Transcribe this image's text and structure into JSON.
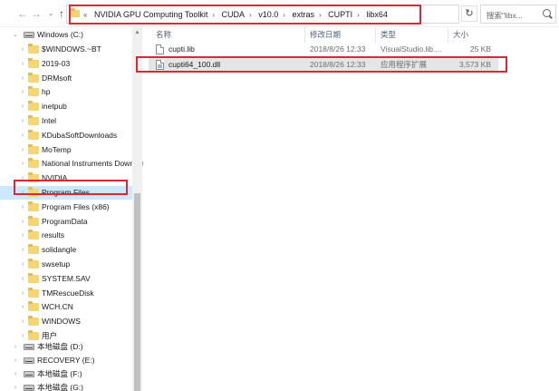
{
  "address_bar": {
    "breadcrumbs": [
      "NVIDIA GPU Computing Toolkit",
      "CUDA",
      "v10.0",
      "extras",
      "CUPTI",
      "libx64"
    ],
    "overflow_chevron": "«",
    "search_placeholder": "搜索\"libx..."
  },
  "nav_icons": {
    "back": "←",
    "forward": "→",
    "history": "⌄",
    "up": "↑",
    "refresh": "↻",
    "dropdown": "⌄"
  },
  "tree": {
    "root_label": "Windows (C:)",
    "folders": [
      "$WINDOWS.~BT",
      "2019-03",
      "DRMsoft",
      "hp",
      "inetpub",
      "Intel",
      "KDubaSoftDownloads",
      "MoTemp",
      "National Instruments Downloads",
      "NVIDIA",
      "Program Files",
      "Program Files (x86)",
      "ProgramData",
      "results",
      "solidangle",
      "swsetup",
      "SYSTEM.SAV",
      "TMRescueDisk",
      "WCH.CN",
      "WINDOWS",
      "用户"
    ],
    "selected": "Program Files",
    "drives": [
      "本地磁盘 (D:)",
      "RECOVERY (E:)",
      "本地磁盘 (F:)",
      "本地磁盘 (G:)"
    ]
  },
  "columns": {
    "name": "名称",
    "date": "修改日期",
    "type": "类型",
    "size": "大小"
  },
  "files": [
    {
      "name": "cupti.lib",
      "date": "2018/8/26 12:33",
      "type": "VisualStudio.lib....",
      "size": "25 KB",
      "icon": "lib-file-icon"
    },
    {
      "name": "cupti64_100.dll",
      "date": "2018/8/26 12:33",
      "type": "应用程序扩展",
      "size": "3,573 KB",
      "icon": "dll-file-icon"
    }
  ],
  "colors": {
    "highlight_red": "#e0272f",
    "selection_blue": "#cce8ff",
    "folder_yellow": "#f5d675"
  }
}
